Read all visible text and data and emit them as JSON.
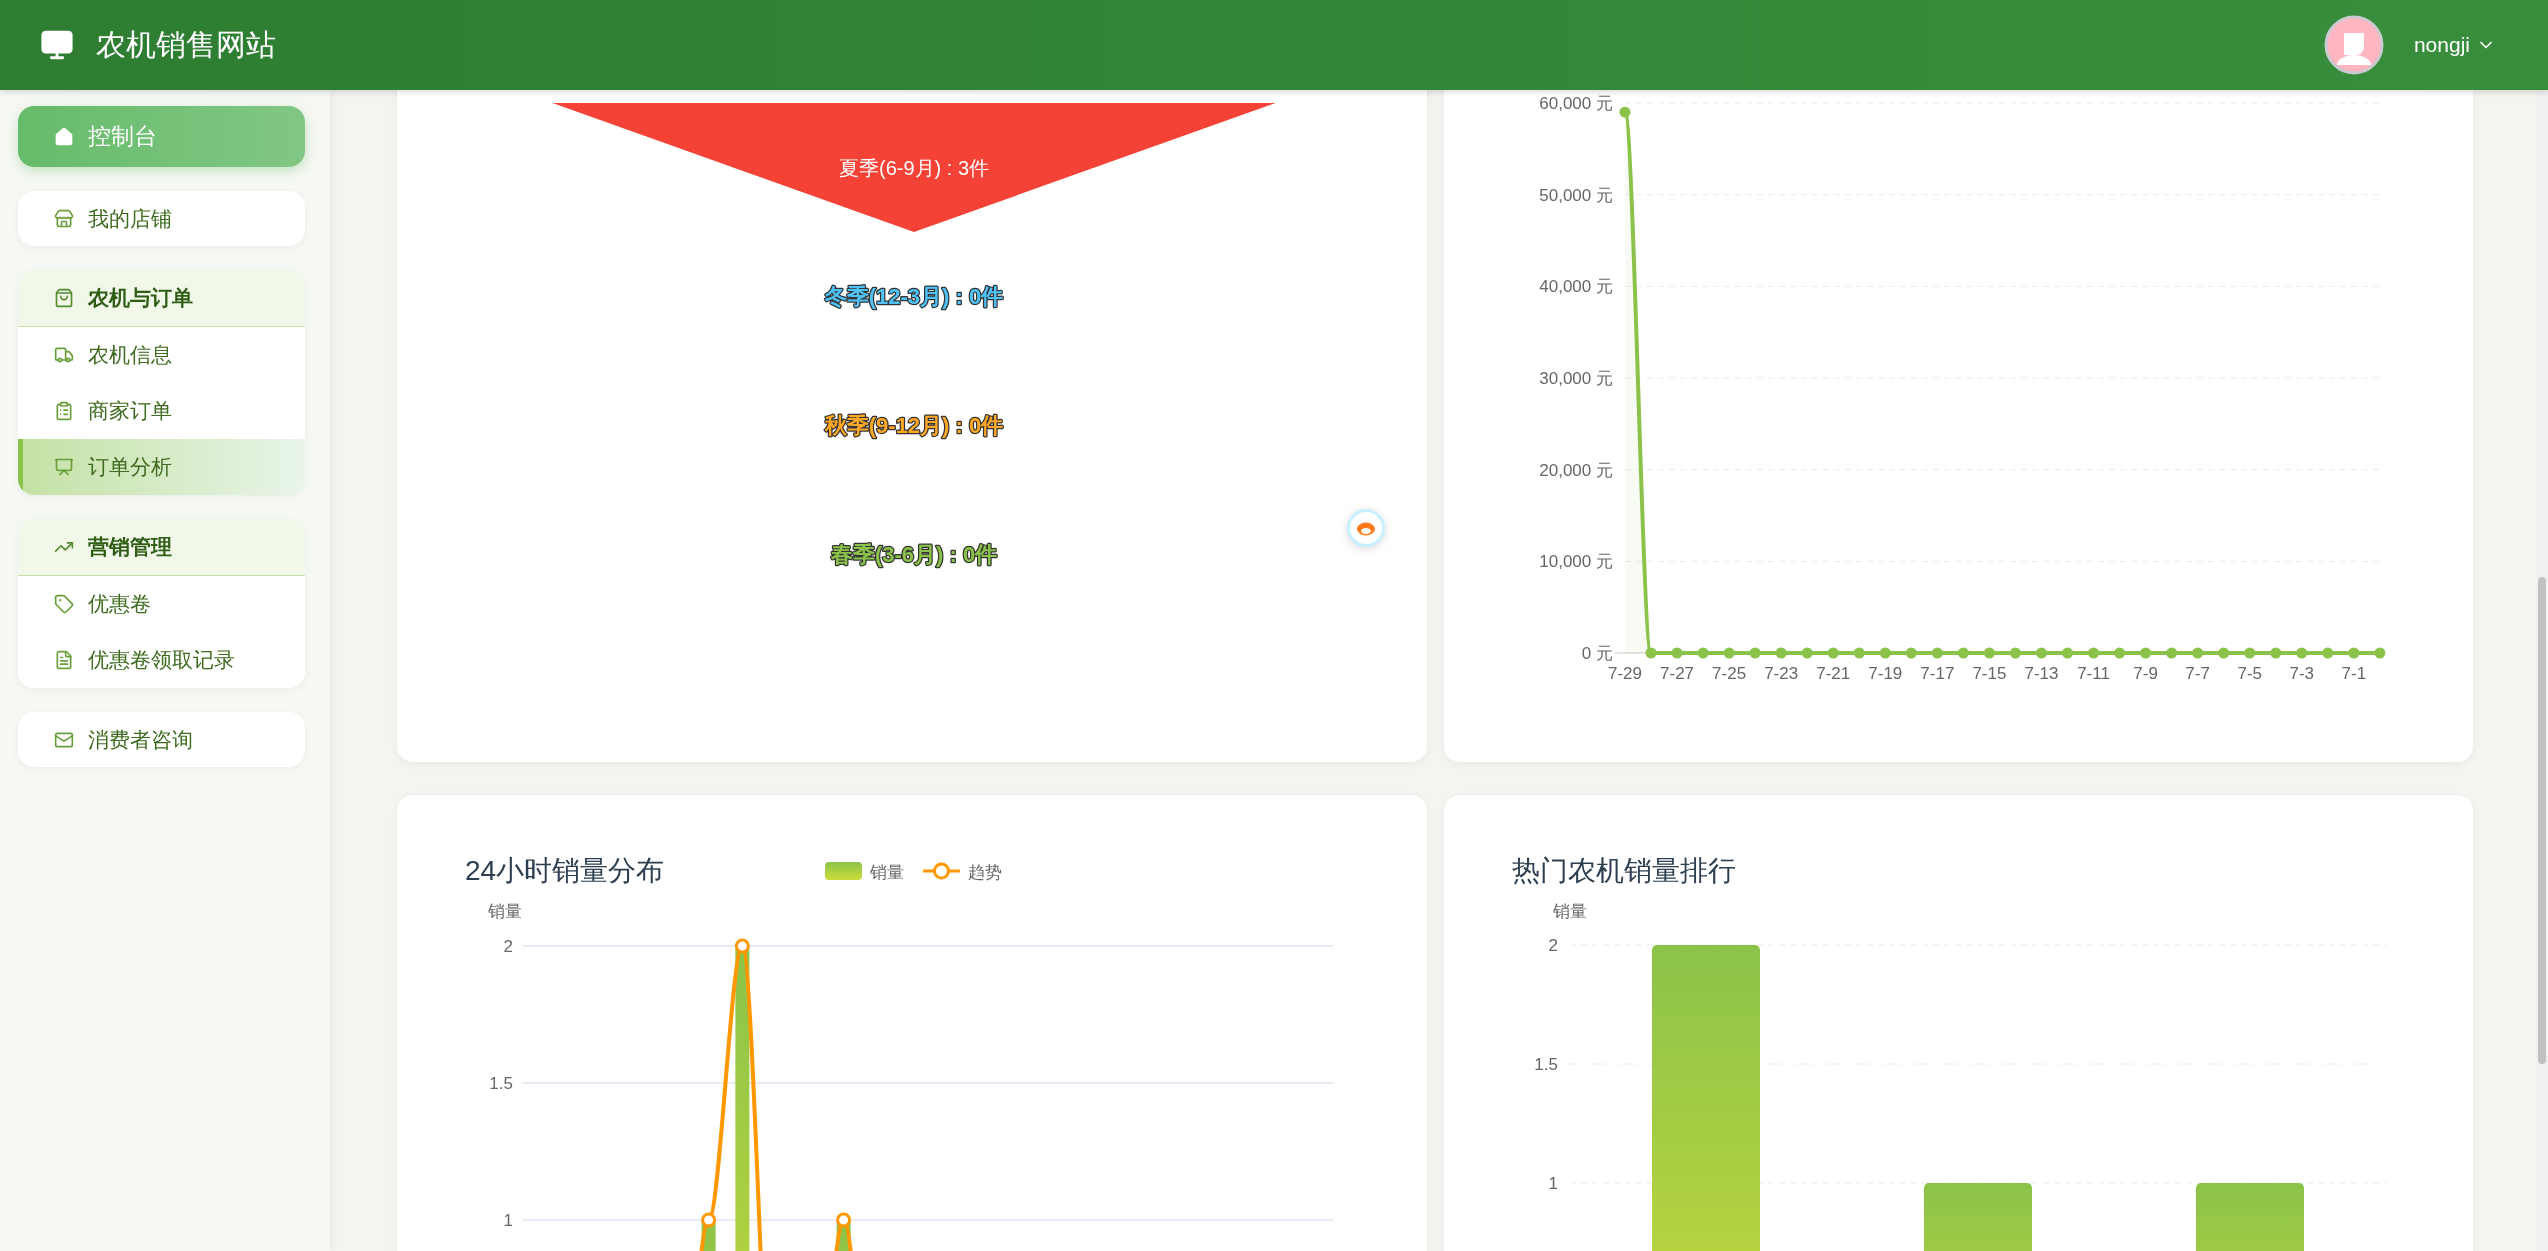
{
  "header": {
    "title": "农机销售网站",
    "user": "nongji"
  },
  "sidebar": {
    "items": [
      {
        "kind": "link",
        "label": "控制台",
        "selected": true
      },
      {
        "kind": "link",
        "label": "我的店铺",
        "selected": false
      },
      {
        "kind": "group",
        "label": "农机与订单",
        "children": [
          {
            "label": "农机信息",
            "selected": false
          },
          {
            "label": "商家订单",
            "selected": false
          },
          {
            "label": "订单分析",
            "selected": true
          }
        ]
      },
      {
        "kind": "group",
        "label": "营销管理",
        "children": [
          {
            "label": "优惠卷",
            "selected": false
          },
          {
            "label": "优惠卷领取记录",
            "selected": false
          }
        ]
      },
      {
        "kind": "link",
        "label": "消费者咨询",
        "selected": false
      }
    ]
  },
  "season_funnel": {
    "stages": [
      {
        "kind": "segment",
        "label": "夏季(6-9月) : 3件",
        "color": "#f44336"
      },
      {
        "kind": "label",
        "label": "冬季(12-3月) : 0件",
        "color": "#4fc3f7"
      },
      {
        "kind": "label",
        "label": "秋季(9-12月) : 0件",
        "color": "#ffa726"
      },
      {
        "kind": "label",
        "label": "春季(3-6月) : 0件",
        "color": "#8bc34a"
      }
    ]
  },
  "revenue_chart": {
    "chart_data": {
      "type": "line",
      "categories": [
        "7-29",
        null,
        "7-27",
        null,
        "7-25",
        null,
        "7-23",
        null,
        "7-21",
        null,
        "7-19",
        null,
        "7-17",
        null,
        "7-15",
        null,
        "7-13",
        null,
        "7-11",
        null,
        "7-9",
        null,
        "7-7",
        null,
        "7-5",
        null,
        "7-3",
        null,
        "7-1",
        null
      ],
      "series": [
        {
          "color": "#8bc34a",
          "marker": true,
          "values": [
            59000,
            0,
            0,
            0,
            0,
            0,
            0,
            0,
            0,
            0,
            0,
            0,
            0,
            0,
            0,
            0,
            0,
            0,
            0,
            0,
            0,
            0,
            0,
            0,
            0,
            0,
            0,
            0,
            0,
            0
          ]
        }
      ],
      "ylim": [
        0,
        60000
      ],
      "grid": true,
      "yticks": [
        {
          "value": 0,
          "label": "0 元"
        },
        {
          "value": 10000,
          "label": "10,000 元"
        },
        {
          "value": 20000,
          "label": "20,000 元"
        },
        {
          "value": 30000,
          "label": "30,000 元"
        },
        {
          "value": 40000,
          "label": "40,000 元"
        },
        {
          "value": 50000,
          "label": "50,000 元"
        },
        {
          "value": 60000,
          "label": "60,000 元"
        }
      ]
    }
  },
  "hourly_chart": {
    "chart_data": {
      "type": "bar",
      "title": "24小时销量分布",
      "ylabel": "销量",
      "series": [
        {
          "name": "销量",
          "type": "bar",
          "color": "#8bc34a",
          "values": [
            0,
            0,
            0,
            0,
            0,
            1,
            2,
            0,
            0,
            1,
            0,
            0,
            0,
            0,
            0,
            0,
            0,
            0,
            0,
            0,
            0,
            0,
            0,
            0
          ]
        },
        {
          "name": "趋势",
          "type": "line",
          "color": "#ff9800",
          "marker": true,
          "values": [
            null,
            null,
            null,
            null,
            0,
            1,
            2,
            0,
            0,
            1,
            0,
            null,
            null,
            null,
            null,
            null,
            null,
            null,
            null,
            null,
            null,
            null,
            null,
            null
          ]
        }
      ],
      "legend": "top",
      "grid": true,
      "ylim": [
        0,
        2
      ],
      "yticks": [
        1,
        1.5,
        2
      ]
    }
  },
  "ranking_chart": {
    "chart_data": {
      "type": "bar",
      "title": "热门农机销量排行",
      "ylabel": "销量",
      "values": [
        2,
        1,
        1
      ],
      "grid": true,
      "ylim": [
        0,
        2
      ],
      "yticks": [
        1,
        1.5,
        2
      ]
    }
  }
}
